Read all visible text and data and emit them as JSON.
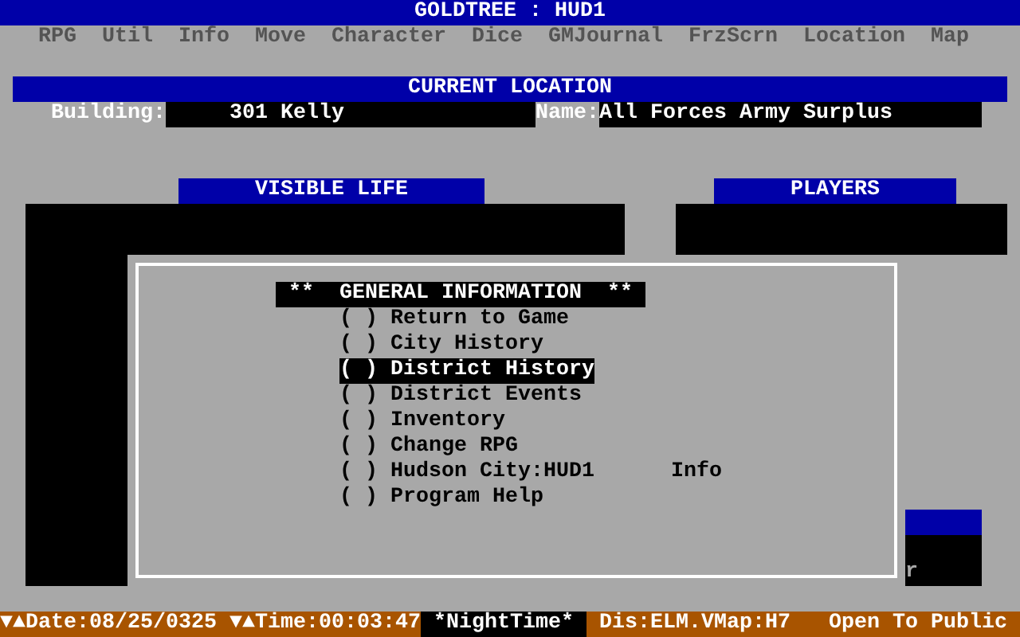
{
  "window": {
    "title": "GOLDTREE : HUD1"
  },
  "menu": [
    "RPG",
    "Util",
    "Info",
    "Move",
    "Character",
    "Dice",
    "GMJournal",
    "FrzScrn",
    "Location",
    "Map"
  ],
  "current_location": {
    "title": "CURRENT LOCATION",
    "building_label": "Building:",
    "building": "301 Kelly",
    "name_label": "Name:",
    "name": "All Forces Army Surplus"
  },
  "panels": {
    "visible_life": "VISIBLE LIFE",
    "players": "PLAYERS",
    "hidden_text": "r"
  },
  "dialog": {
    "title": "**  GENERAL INFORMATION  **",
    "items": [
      {
        "marker": "( )",
        "label": "Return to Game",
        "selected": false
      },
      {
        "marker": "( )",
        "label": "City History",
        "selected": false
      },
      {
        "marker": "( )",
        "label": "District History",
        "selected": true
      },
      {
        "marker": "( )",
        "label": "District Events",
        "selected": false
      },
      {
        "marker": "( )",
        "label": "Inventory",
        "selected": false
      },
      {
        "marker": "( )",
        "label": "Change RPG",
        "selected": false
      },
      {
        "marker": "( )",
        "label": "Hudson City:HUD1",
        "extra": "Info",
        "selected": false
      },
      {
        "marker": "( )",
        "label": "Program Help",
        "selected": false
      }
    ]
  },
  "status_bar": {
    "date": "▼▲Date:08/25/0325",
    "time": "▼▲Time:00:03:47",
    "period": "*NightTime*",
    "district": "Dis:ELM.VMap:H7",
    "access": "Open To Public"
  }
}
